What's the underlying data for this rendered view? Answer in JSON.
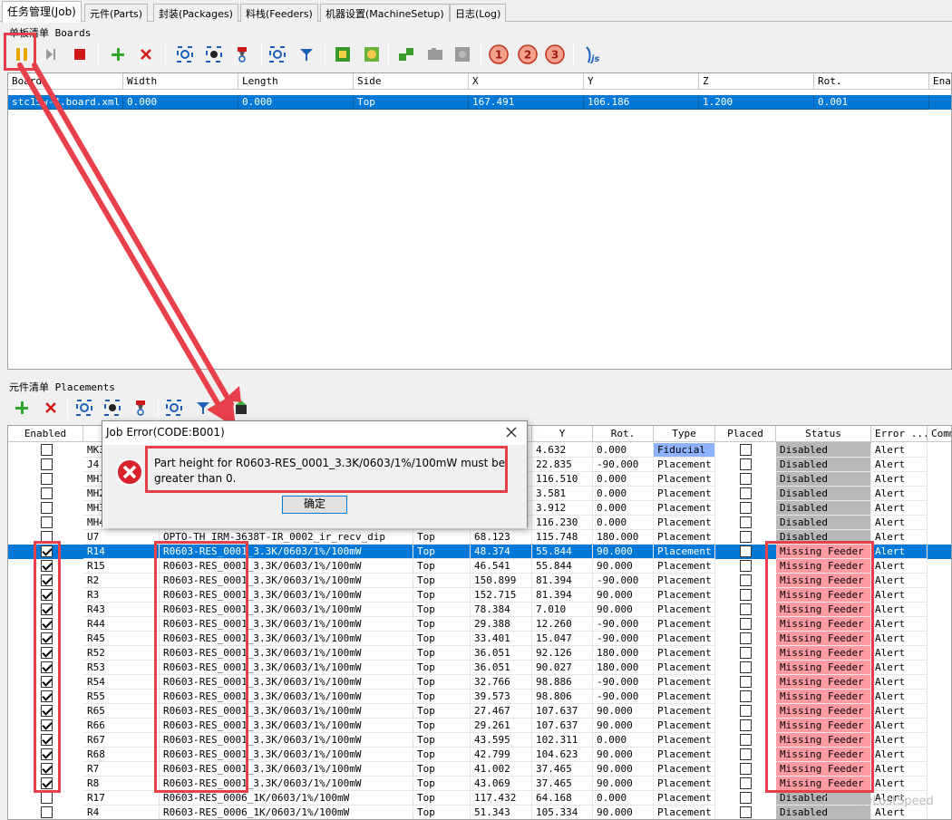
{
  "tabs": [
    "任务管理(Job)",
    "元件(Parts)",
    "封装(Packages)",
    "料栈(Feeders)",
    "机器设置(MachineSetup)",
    "日志(Log)"
  ],
  "boards_group_label": "单板清单 Boards",
  "boards_columns": [
    "Board",
    "Width",
    "Length",
    "Side",
    "X",
    "Y",
    "Z",
    "Rot.",
    "Enab"
  ],
  "boards_rows": [
    [
      "stc15w-4.board.xml",
      "0.000",
      "0.000",
      "Top",
      "167.491",
      "106.186",
      "1.200",
      "0.001",
      ""
    ]
  ],
  "placements_group_label": "元件清单 Placements",
  "placements_columns": [
    "Enabled",
    "",
    "",
    "",
    "",
    "Y",
    "Rot.",
    "Type",
    "Placed",
    "Status",
    "Error ...",
    "Comm"
  ],
  "placements_rows": [
    {
      "enabled": false,
      "id": "MK3",
      "part": "",
      "side": "",
      "x": "",
      "y": "4.632",
      "rot": "0.000",
      "type": "Fiducial",
      "placed": false,
      "status": "Disabled",
      "err": "Alert"
    },
    {
      "enabled": false,
      "id": "J4",
      "part": "",
      "side": "",
      "x": "",
      "y": "22.835",
      "rot": "-90.000",
      "type": "Placement",
      "placed": false,
      "status": "Disabled",
      "err": "Alert"
    },
    {
      "enabled": false,
      "id": "MH1",
      "part": "",
      "side": "",
      "x": "",
      "y": "116.510",
      "rot": "0.000",
      "type": "Placement",
      "placed": false,
      "status": "Disabled",
      "err": "Alert"
    },
    {
      "enabled": false,
      "id": "MH2",
      "part": "",
      "side": "",
      "x": "",
      "y": "3.581",
      "rot": "0.000",
      "type": "Placement",
      "placed": false,
      "status": "Disabled",
      "err": "Alert"
    },
    {
      "enabled": false,
      "id": "MH3",
      "part": "",
      "side": "",
      "x": "",
      "y": "3.912",
      "rot": "0.000",
      "type": "Placement",
      "placed": false,
      "status": "Disabled",
      "err": "Alert"
    },
    {
      "enabled": false,
      "id": "MH4",
      "part": "",
      "side": "",
      "x": "",
      "y": "116.230",
      "rot": "0.000",
      "type": "Placement",
      "placed": false,
      "status": "Disabled",
      "err": "Alert"
    },
    {
      "enabled": false,
      "id": "U7",
      "part": "OPTO-TH_IRM-3638T-IR_0002_ir_recv_dip",
      "side": "Top",
      "x": "68.123",
      "y": "115.748",
      "rot": "180.000",
      "type": "Placement",
      "placed": false,
      "status": "Disabled",
      "err": "Alert"
    },
    {
      "enabled": true,
      "id": "R14",
      "part": "R0603-RES_0001_3.3K/0603/1%/100mW",
      "side": "Top",
      "x": "48.374",
      "y": "55.844",
      "rot": "90.000",
      "type": "Placement",
      "placed": false,
      "status": "Missing Feeder",
      "err": "Alert",
      "selected": true
    },
    {
      "enabled": true,
      "id": "R15",
      "part": "R0603-RES_0001_3.3K/0603/1%/100mW",
      "side": "Top",
      "x": "46.541",
      "y": "55.844",
      "rot": "90.000",
      "type": "Placement",
      "placed": false,
      "status": "Missing Feeder",
      "err": "Alert"
    },
    {
      "enabled": true,
      "id": "R2",
      "part": "R0603-RES_0001_3.3K/0603/1%/100mW",
      "side": "Top",
      "x": "150.899",
      "y": "81.394",
      "rot": "-90.000",
      "type": "Placement",
      "placed": false,
      "status": "Missing Feeder",
      "err": "Alert"
    },
    {
      "enabled": true,
      "id": "R3",
      "part": "R0603-RES_0001_3.3K/0603/1%/100mW",
      "side": "Top",
      "x": "152.715",
      "y": "81.394",
      "rot": "90.000",
      "type": "Placement",
      "placed": false,
      "status": "Missing Feeder",
      "err": "Alert"
    },
    {
      "enabled": true,
      "id": "R43",
      "part": "R0603-RES_0001_3.3K/0603/1%/100mW",
      "side": "Top",
      "x": "78.384",
      "y": "7.010",
      "rot": "90.000",
      "type": "Placement",
      "placed": false,
      "status": "Missing Feeder",
      "err": "Alert"
    },
    {
      "enabled": true,
      "id": "R44",
      "part": "R0603-RES_0001_3.3K/0603/1%/100mW",
      "side": "Top",
      "x": "29.388",
      "y": "12.260",
      "rot": "-90.000",
      "type": "Placement",
      "placed": false,
      "status": "Missing Feeder",
      "err": "Alert"
    },
    {
      "enabled": true,
      "id": "R45",
      "part": "R0603-RES_0001_3.3K/0603/1%/100mW",
      "side": "Top",
      "x": "33.401",
      "y": "15.047",
      "rot": "-90.000",
      "type": "Placement",
      "placed": false,
      "status": "Missing Feeder",
      "err": "Alert"
    },
    {
      "enabled": true,
      "id": "R52",
      "part": "R0603-RES_0001_3.3K/0603/1%/100mW",
      "side": "Top",
      "x": "36.051",
      "y": "92.126",
      "rot": "180.000",
      "type": "Placement",
      "placed": false,
      "status": "Missing Feeder",
      "err": "Alert"
    },
    {
      "enabled": true,
      "id": "R53",
      "part": "R0603-RES_0001_3.3K/0603/1%/100mW",
      "side": "Top",
      "x": "36.051",
      "y": "90.027",
      "rot": "180.000",
      "type": "Placement",
      "placed": false,
      "status": "Missing Feeder",
      "err": "Alert"
    },
    {
      "enabled": true,
      "id": "R54",
      "part": "R0603-RES_0001_3.3K/0603/1%/100mW",
      "side": "Top",
      "x": "32.766",
      "y": "98.886",
      "rot": "-90.000",
      "type": "Placement",
      "placed": false,
      "status": "Missing Feeder",
      "err": "Alert"
    },
    {
      "enabled": true,
      "id": "R55",
      "part": "R0603-RES_0001_3.3K/0603/1%/100mW",
      "side": "Top",
      "x": "39.573",
      "y": "98.806",
      "rot": "-90.000",
      "type": "Placement",
      "placed": false,
      "status": "Missing Feeder",
      "err": "Alert"
    },
    {
      "enabled": true,
      "id": "R65",
      "part": "R0603-RES_0001_3.3K/0603/1%/100mW",
      "side": "Top",
      "x": "27.467",
      "y": "107.637",
      "rot": "90.000",
      "type": "Placement",
      "placed": false,
      "status": "Missing Feeder",
      "err": "Alert"
    },
    {
      "enabled": true,
      "id": "R66",
      "part": "R0603-RES_0001_3.3K/0603/1%/100mW",
      "side": "Top",
      "x": "29.261",
      "y": "107.637",
      "rot": "90.000",
      "type": "Placement",
      "placed": false,
      "status": "Missing Feeder",
      "err": "Alert"
    },
    {
      "enabled": true,
      "id": "R67",
      "part": "R0603-RES_0001_3.3K/0603/1%/100mW",
      "side": "Top",
      "x": "43.595",
      "y": "102.311",
      "rot": "0.000",
      "type": "Placement",
      "placed": false,
      "status": "Missing Feeder",
      "err": "Alert"
    },
    {
      "enabled": true,
      "id": "R68",
      "part": "R0603-RES_0001_3.3K/0603/1%/100mW",
      "side": "Top",
      "x": "42.799",
      "y": "104.623",
      "rot": "90.000",
      "type": "Placement",
      "placed": false,
      "status": "Missing Feeder",
      "err": "Alert"
    },
    {
      "enabled": true,
      "id": "R7",
      "part": "R0603-RES_0001_3.3K/0603/1%/100mW",
      "side": "Top",
      "x": "41.002",
      "y": "37.465",
      "rot": "90.000",
      "type": "Placement",
      "placed": false,
      "status": "Missing Feeder",
      "err": "Alert"
    },
    {
      "enabled": true,
      "id": "R8",
      "part": "R0603-RES_0001_3.3K/0603/1%/100mW",
      "side": "Top",
      "x": "43.069",
      "y": "37.465",
      "rot": "90.000",
      "type": "Placement",
      "placed": false,
      "status": "Missing Feeder",
      "err": "Alert"
    },
    {
      "enabled": false,
      "id": "R17",
      "part": "R0603-RES_0006_1K/0603/1%/100mW",
      "side": "Top",
      "x": "117.432",
      "y": "64.168",
      "rot": "0.000",
      "type": "Placement",
      "placed": false,
      "status": "Disabled",
      "err": "Alert"
    },
    {
      "enabled": false,
      "id": "R4",
      "part": "R0603-RES_0006_1K/0603/1%/100mW",
      "side": "Top",
      "x": "51.343",
      "y": "105.334",
      "rot": "90.000",
      "type": "Placement",
      "placed": false,
      "status": "Disabled",
      "err": "Alert"
    }
  ],
  "dialog": {
    "title": "Job Error(CODE:B001)",
    "message": "Part height for R0603-RES_0001_3.3K/0603/1%/100mW must be greater than 0.",
    "ok_label": "确定"
  },
  "toolbar_numbers": [
    "1",
    "2",
    "3"
  ],
  "toolbar_js_label": "js",
  "watermark": "CSDN @LostSpeed",
  "colors": {
    "selection": "#0078d7",
    "missing_feeder": "#ff9aa2",
    "status_bg": "#b8b8b8",
    "annotation_red": "#e8404a",
    "error_icon": "#d9232e"
  }
}
